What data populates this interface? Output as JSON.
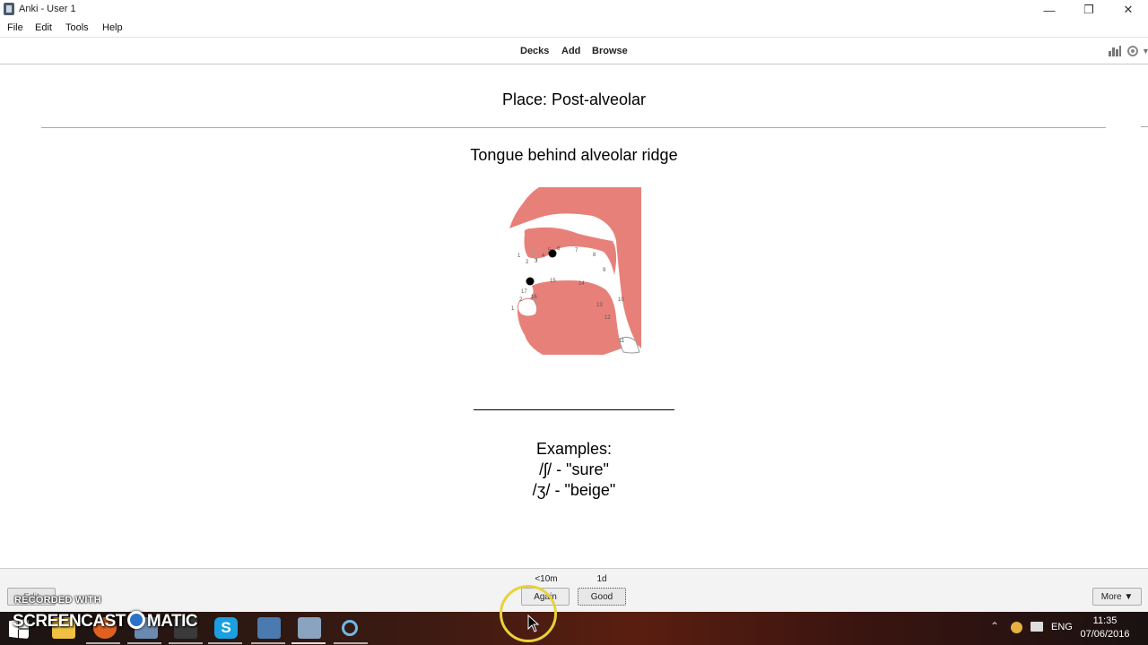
{
  "window": {
    "title": "Anki - User 1"
  },
  "menu": [
    "File",
    "Edit",
    "Tools",
    "Help"
  ],
  "toolbar": {
    "decks": "Decks",
    "add": "Add",
    "browse": "Browse"
  },
  "card": {
    "front": "Place: Post-alveolar",
    "description": "Tongue behind alveolar ridge",
    "diagram_labels": [
      "1",
      "2",
      "3",
      "4",
      "5",
      "6",
      "7",
      "8",
      "9",
      "10",
      "11",
      "12",
      "13",
      "14",
      "15",
      "16",
      "17",
      "1",
      "2"
    ],
    "examples_heading": "Examples:",
    "examples": [
      "/ʃ/ - \"sure\"",
      "/ʒ/ - \"beige\""
    ]
  },
  "review": {
    "again_interval": "<10m",
    "good_interval": "1d",
    "again_label": "Again",
    "good_label": "Good",
    "edit_label": "Edit",
    "more_label": "More ▼"
  },
  "watermark": {
    "line1": "RECORDED WITH",
    "line2a": "SCREENCAST",
    "line2b": "MATIC"
  },
  "taskbar": {
    "lang": "ENG",
    "time": "11:35",
    "date": "07/06/2016"
  },
  "colors": {
    "diagram_fill": "#e8807a",
    "ring": "#e8d23a"
  }
}
